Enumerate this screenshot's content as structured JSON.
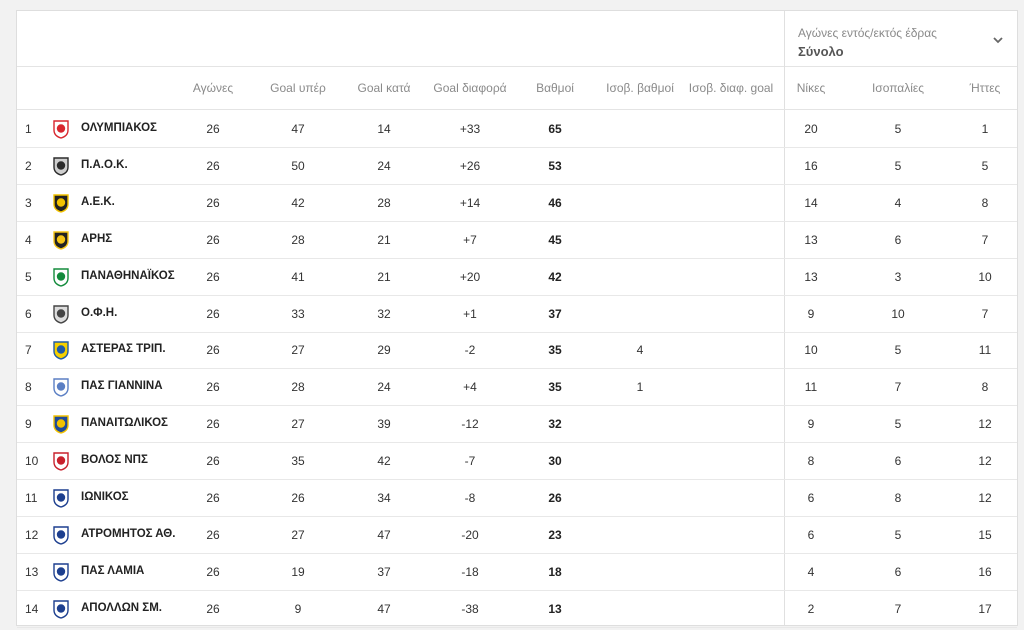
{
  "filter": {
    "label": "Αγώνες εντός/εκτός έδρας",
    "value": "Σύνολο"
  },
  "headers": {
    "played": "Αγώνες",
    "goals_for": "Goal υπέρ",
    "goals_against": "Goal κατά",
    "goal_diff": "Goal διαφορά",
    "points": "Βαθμοί",
    "tie_points": "Ισοβ. βαθμοί",
    "tie_gd": "Ισοβ. διαφ. goal",
    "wins": "Νίκες",
    "draws": "Ισοπαλίες",
    "losses": "Ήττες"
  },
  "rows": [
    {
      "pos": "1",
      "team": "ΟΛΥΜΠΙΑΚΟΣ",
      "played": "26",
      "gf": "47",
      "ga": "14",
      "gd": "+33",
      "pts": "65",
      "tp": "",
      "tgd": "",
      "w": "20",
      "d": "5",
      "l": "1",
      "logo": "olympiakos-logo",
      "c1": "#d8262e",
      "c2": "#ffffff"
    },
    {
      "pos": "2",
      "team": "Π.Α.Ο.Κ.",
      "played": "26",
      "gf": "50",
      "ga": "24",
      "gd": "+26",
      "pts": "53",
      "tp": "",
      "tgd": "",
      "w": "16",
      "d": "5",
      "l": "5",
      "logo": "paok-logo",
      "c1": "#2b2b2b",
      "c2": "#cfcfcf"
    },
    {
      "pos": "3",
      "team": "Α.Ε.Κ.",
      "played": "26",
      "gf": "42",
      "ga": "28",
      "gd": "+14",
      "pts": "46",
      "tp": "",
      "tgd": "",
      "w": "14",
      "d": "4",
      "l": "8",
      "logo": "aek-logo",
      "c1": "#f2c200",
      "c2": "#222222"
    },
    {
      "pos": "4",
      "team": "ΑΡΗΣ",
      "played": "26",
      "gf": "28",
      "ga": "21",
      "gd": "+7",
      "pts": "45",
      "tp": "",
      "tgd": "",
      "w": "13",
      "d": "6",
      "l": "7",
      "logo": "aris-logo",
      "c1": "#f5c518",
      "c2": "#222222"
    },
    {
      "pos": "5",
      "team": "ΠΑΝΑΘΗΝΑΪΚΟΣ",
      "played": "26",
      "gf": "41",
      "ga": "21",
      "gd": "+20",
      "pts": "42",
      "tp": "",
      "tgd": "",
      "w": "13",
      "d": "3",
      "l": "10",
      "logo": "panathinaikos-logo",
      "c1": "#138b3c",
      "c2": "#ffffff"
    },
    {
      "pos": "6",
      "team": "Ο.Φ.Η.",
      "played": "26",
      "gf": "33",
      "ga": "32",
      "gd": "+1",
      "pts": "37",
      "tp": "",
      "tgd": "",
      "w": "9",
      "d": "10",
      "l": "7",
      "logo": "ofi-logo",
      "c1": "#444444",
      "c2": "#dddddd"
    },
    {
      "pos": "7",
      "team": "ΑΣΤΕΡΑΣ ΤΡΙΠ.",
      "played": "26",
      "gf": "27",
      "ga": "29",
      "gd": "-2",
      "pts": "35",
      "tp": "4",
      "tgd": "",
      "w": "10",
      "d": "5",
      "l": "11",
      "logo": "asteras-logo",
      "c1": "#1f5ba8",
      "c2": "#f5d000"
    },
    {
      "pos": "8",
      "team": "ΠΑΣ ΓΙΑΝΝΙΝΑ",
      "played": "26",
      "gf": "28",
      "ga": "24",
      "gd": "+4",
      "pts": "35",
      "tp": "1",
      "tgd": "",
      "w": "11",
      "d": "7",
      "l": "8",
      "logo": "pas-giannina-logo",
      "c1": "#5b7fc4",
      "c2": "#ffffff"
    },
    {
      "pos": "9",
      "team": "ΠΑΝΑΙΤΩΛΙΚΟΣ",
      "played": "26",
      "gf": "27",
      "ga": "39",
      "gd": "-12",
      "pts": "32",
      "tp": "",
      "tgd": "",
      "w": "9",
      "d": "5",
      "l": "12",
      "logo": "panetolikos-logo",
      "c1": "#f2c200",
      "c2": "#1e4a9a"
    },
    {
      "pos": "10",
      "team": "ΒΟΛΟΣ ΝΠΣ",
      "played": "26",
      "gf": "35",
      "ga": "42",
      "gd": "-7",
      "pts": "30",
      "tp": "",
      "tgd": "",
      "w": "8",
      "d": "6",
      "l": "12",
      "logo": "volos-logo",
      "c1": "#c8202c",
      "c2": "#ffffff"
    },
    {
      "pos": "11",
      "team": "ΙΩΝΙΚΟΣ",
      "played": "26",
      "gf": "26",
      "ga": "34",
      "gd": "-8",
      "pts": "26",
      "tp": "",
      "tgd": "",
      "w": "6",
      "d": "8",
      "l": "12",
      "logo": "ionikos-logo",
      "c1": "#1d3f8f",
      "c2": "#ffffff"
    },
    {
      "pos": "12",
      "team": "ΑΤΡΟΜΗΤΟΣ ΑΘ.",
      "played": "26",
      "gf": "27",
      "ga": "47",
      "gd": "-20",
      "pts": "23",
      "tp": "",
      "tgd": "",
      "w": "6",
      "d": "5",
      "l": "15",
      "logo": "atromitos-logo",
      "c1": "#1d3f8f",
      "c2": "#ffffff"
    },
    {
      "pos": "13",
      "team": "ΠΑΣ ΛΑΜΙΑ",
      "played": "26",
      "gf": "19",
      "ga": "37",
      "gd": "-18",
      "pts": "18",
      "tp": "",
      "tgd": "",
      "w": "4",
      "d": "6",
      "l": "16",
      "logo": "lamia-logo",
      "c1": "#1d3f8f",
      "c2": "#ffffff"
    },
    {
      "pos": "14",
      "team": "ΑΠΟΛΛΩΝ ΣΜ.",
      "played": "26",
      "gf": "9",
      "ga": "47",
      "gd": "-38",
      "pts": "13",
      "tp": "",
      "tgd": "",
      "w": "2",
      "d": "7",
      "l": "17",
      "logo": "apollon-logo",
      "c1": "#1d3f8f",
      "c2": "#ffffff"
    }
  ]
}
